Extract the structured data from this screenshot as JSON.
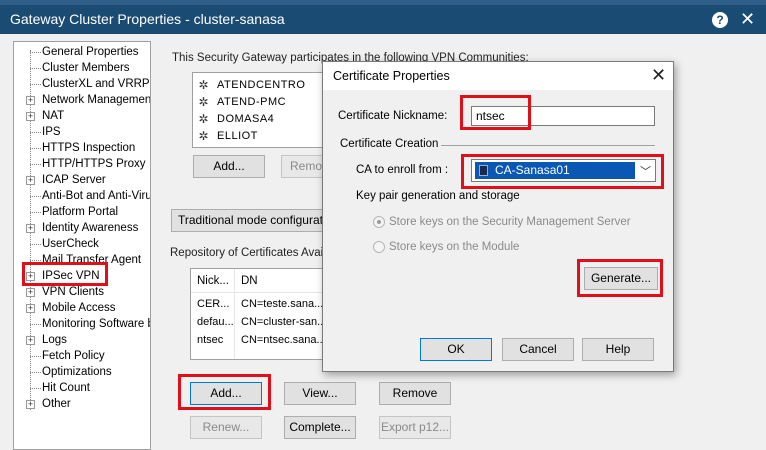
{
  "window": {
    "title": "Gateway Cluster Properties - cluster-sanasa",
    "help_label": "?",
    "close_label": "✕"
  },
  "tree": {
    "items": [
      {
        "label": "General Properties",
        "expandable": false
      },
      {
        "label": "Cluster Members",
        "expandable": false
      },
      {
        "label": "ClusterXL and VRRP",
        "expandable": false
      },
      {
        "label": "Network Management",
        "expandable": true
      },
      {
        "label": "NAT",
        "expandable": true
      },
      {
        "label": "IPS",
        "expandable": false
      },
      {
        "label": "HTTPS Inspection",
        "expandable": false
      },
      {
        "label": "HTTP/HTTPS Proxy",
        "expandable": false
      },
      {
        "label": "ICAP Server",
        "expandable": true
      },
      {
        "label": "Anti-Bot and Anti-Virus",
        "expandable": false
      },
      {
        "label": "Platform Portal",
        "expandable": false
      },
      {
        "label": "Identity Awareness",
        "expandable": true
      },
      {
        "label": "UserCheck",
        "expandable": false
      },
      {
        "label": "Mail Transfer Agent",
        "expandable": false
      },
      {
        "label": "IPSec VPN",
        "expandable": true
      },
      {
        "label": "VPN Clients",
        "expandable": true
      },
      {
        "label": "Mobile Access",
        "expandable": true
      },
      {
        "label": "Monitoring Software bla",
        "expandable": false
      },
      {
        "label": "Logs",
        "expandable": true
      },
      {
        "label": "Fetch Policy",
        "expandable": false
      },
      {
        "label": "Optimizations",
        "expandable": false
      },
      {
        "label": "Hit Count",
        "expandable": false
      },
      {
        "label": "Other",
        "expandable": true
      }
    ]
  },
  "main": {
    "vpn_text": "This Security Gateway participates in the following VPN Communities:",
    "communities": [
      "ATENDCENTRO",
      "ATEND-PMC",
      "DOMASA4",
      "ELLIOT"
    ],
    "community_add_label": "Add...",
    "community_remove_label": "Remo",
    "traditional_mode_label": "Traditional mode configuration...",
    "repository_text": "Repository of Certificates Available",
    "cert_columns": [
      "Nick...",
      "DN"
    ],
    "cert_rows": [
      [
        "CER...",
        "CN=teste.sana..."
      ],
      [
        "defau...",
        "CN=cluster-san..."
      ],
      [
        "ntsec",
        "CN=ntsec.sana..."
      ]
    ],
    "buttons": {
      "add": "Add...",
      "view": "View...",
      "remove": "Remove",
      "renew": "Renew...",
      "complete": "Complete...",
      "export": "Export p12..."
    }
  },
  "dialog": {
    "title": "Certificate Properties",
    "close_label": "✕",
    "nickname_label": "Certificate Nickname:",
    "nickname_value": "ntsec",
    "creation_label": "Certificate Creation",
    "ca_label": "CA to enroll from :",
    "ca_value": "CA-Sanasa01",
    "keypair_label": "Key pair generation and storage",
    "radio_mgmt": "Store keys on the Security Management Server",
    "radio_module": "Store keys on the Module",
    "generate_label": "Generate...",
    "ok_label": "OK",
    "cancel_label": "Cancel",
    "help_label": "Help"
  },
  "colors": {
    "title_bar": "#1a4b73",
    "highlight_box": "#e0101a",
    "selection": "#0a58b4"
  }
}
